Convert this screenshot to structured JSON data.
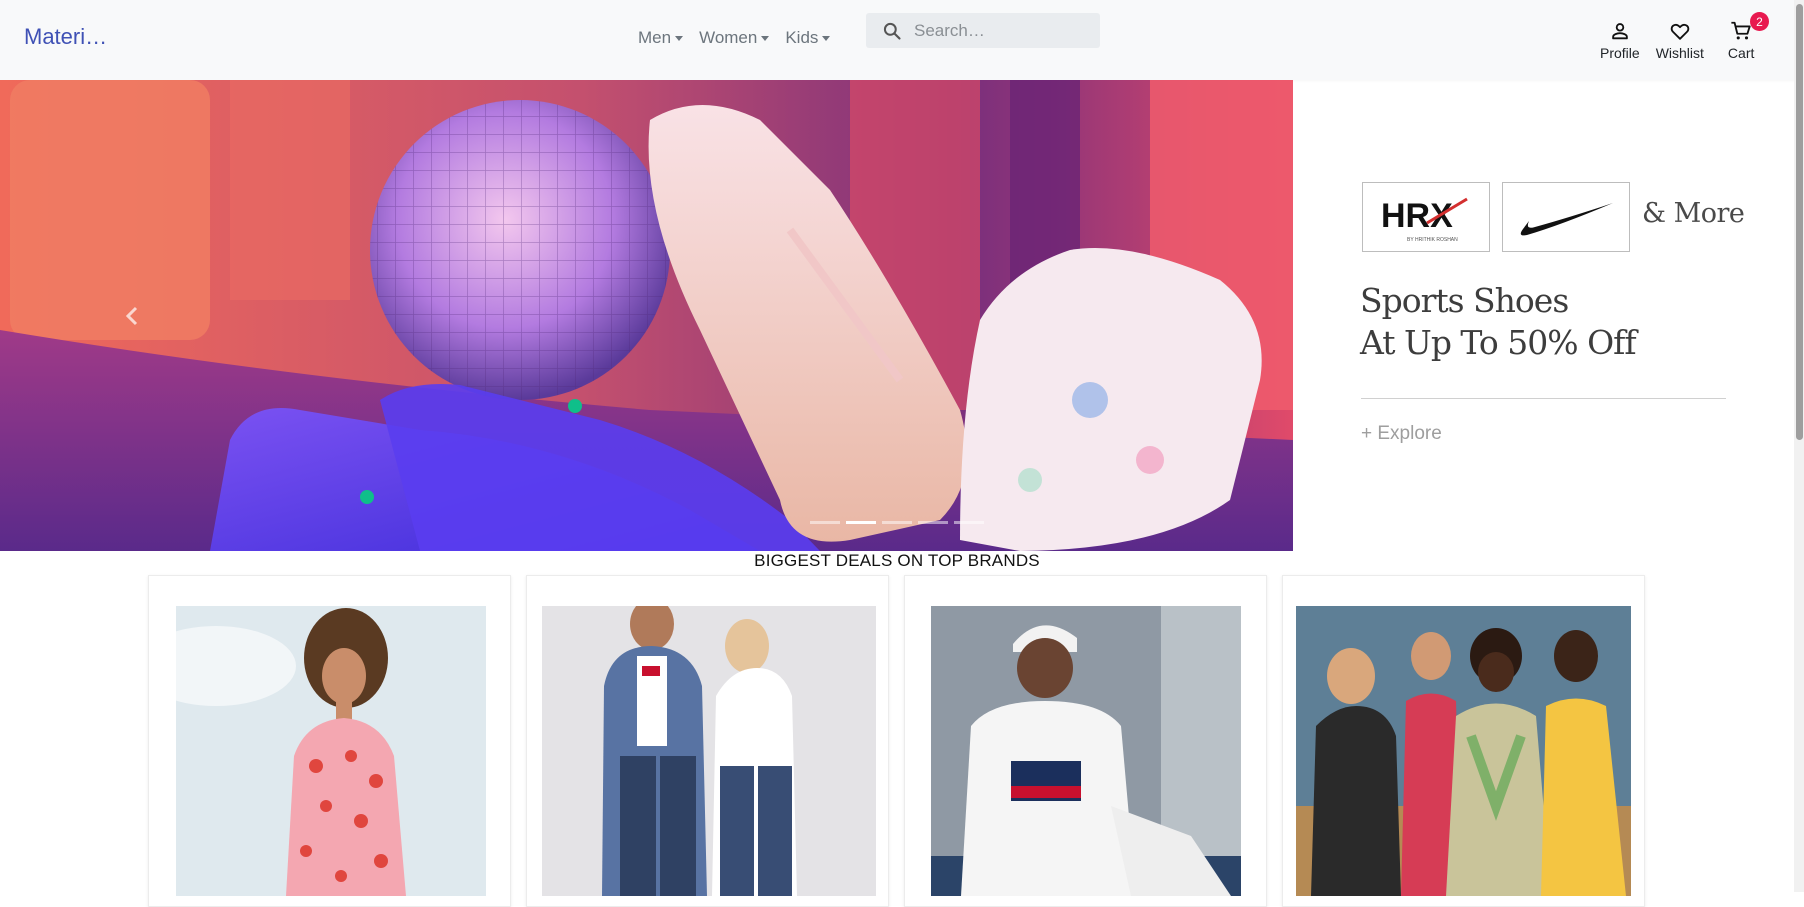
{
  "header": {
    "brand": "Materi…",
    "nav": [
      {
        "label": "Men"
      },
      {
        "label": "Women"
      },
      {
        "label": "Kids"
      }
    ],
    "search": {
      "placeholder": "Search…",
      "icon": "search-icon"
    },
    "actions": [
      {
        "label": "Profile",
        "icon": "person-icon"
      },
      {
        "label": "Wishlist",
        "icon": "heart-icon"
      },
      {
        "label": "Cart",
        "icon": "cart-icon",
        "badge": "2"
      }
    ]
  },
  "hero": {
    "brands": [
      "HRX",
      "Nike"
    ],
    "brand_subtext": "BY HRITHIK ROSHAN",
    "more": "& More",
    "title_line1": "Sports Shoes",
    "title_line2": "At Up To 50% Off",
    "cta": "+ Explore",
    "carousel_slides": 5,
    "active_slide": 2
  },
  "deals": {
    "title": "BIGGEST DEALS ON TOP BRANDS",
    "cards": [
      {
        "image": "woman-pink-floral-dress"
      },
      {
        "image": "couple-denim-jeans"
      },
      {
        "image": "man-white-tee-beanie"
      },
      {
        "image": "group-athletic-wear"
      }
    ]
  },
  "colors": {
    "brand": "#3f51b5",
    "badge": "#e8194f",
    "header_bg": "#f8f9fa"
  }
}
